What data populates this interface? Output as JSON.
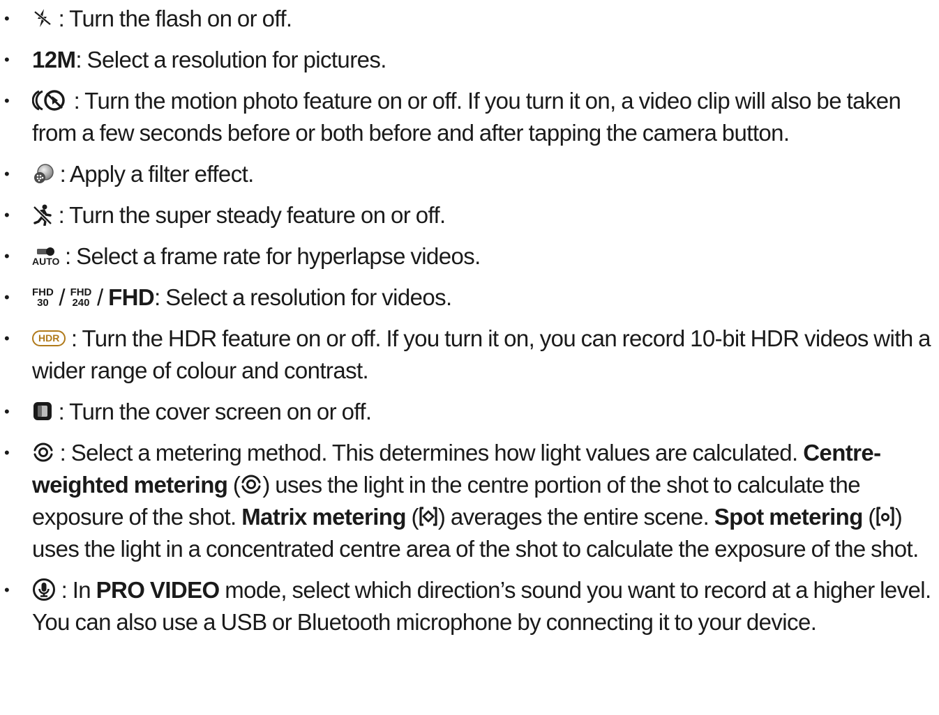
{
  "items": [
    {
      "icon": "flash-off-icon",
      "text": ": Turn the flash on or off."
    },
    {
      "label": "12M",
      "text": ": Select a resolution for pictures."
    },
    {
      "icon": "motion-photo-icon",
      "text": ": Turn the motion photo feature on or off. If you turn it on, a video clip will also be taken from a few seconds before or both before and after tapping the camera button."
    },
    {
      "icon": "filter-icon",
      "text": ": Apply a filter effect."
    },
    {
      "icon": "super-steady-icon",
      "text": ": Turn the super steady feature on or off."
    },
    {
      "icon": "hyperlapse-frame-rate-icon",
      "icon_text": "AUTO",
      "text": ": Select a frame rate for hyperlapse videos."
    },
    {
      "icon_fhd30_top": "FHD",
      "icon_fhd30_bottom": "30",
      "icon_fhd240_top": "FHD",
      "icon_fhd240_bottom": "240",
      "sep": "/",
      "label": "FHD",
      "text": ": Select a resolution for videos."
    },
    {
      "icon": "hdr-icon",
      "icon_text": "HDR",
      "text": ": Turn the HDR feature on or off. If you turn it on, you can record 10-bit HDR videos with a wider range of colour and contrast."
    },
    {
      "icon": "cover-screen-icon",
      "text": ": Turn the cover screen on or off."
    },
    {
      "icon": "metering-icon",
      "text": ": Select a metering method. This determines how light values are calculated.",
      "centre_label": "Centre-weighted metering",
      "centre_text": ") uses the light in the centre portion of the shot to calculate the exposure of the shot.",
      "matrix_label": "Matrix metering",
      "matrix_text": ") averages the entire scene.",
      "spot_label": "Spot metering",
      "spot_text": ") uses the light in a concentrated centre area of the shot to calculate the exposure of the shot.",
      "open_paren": "("
    },
    {
      "icon": "microphone-icon",
      "text_before": ": In",
      "label": "PRO VIDEO",
      "text_after": "mode, select which direction’s sound you want to record at a higher level. You can also use a USB or Bluetooth microphone by connecting it to your device."
    }
  ],
  "colors": {
    "text": "#1a1a1a",
    "hdr_accent": "#b07a1a"
  }
}
